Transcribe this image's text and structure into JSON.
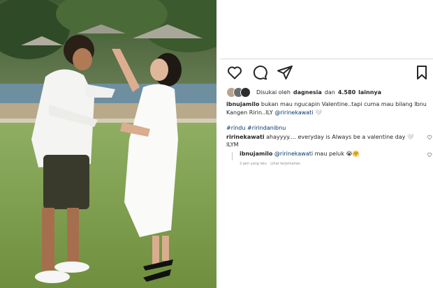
{
  "post": {
    "likes": {
      "prefix": "Disukai oleh",
      "user": "dagnesia",
      "middle": "dan",
      "count": "4.580",
      "suffix": "lainnya"
    },
    "caption": {
      "username": "ibnujamilo",
      "text": "bukan mau ngucapin Valentine..tapi cuma mau bilang Ibnu Kangen Ririn..ILY",
      "mention": "@ririnekawati",
      "emoji": "🤍"
    },
    "hashtags": [
      "#rindu",
      "#ririndanibnu"
    ],
    "comments": [
      {
        "username": "ririnekawati",
        "text": "ahayyyy.... everyday is Always be a valentine day",
        "emoji": "🤍",
        "text2": "ILYM"
      }
    ],
    "reply": {
      "username": "ibnujamilo",
      "mention": "@ririnekawati",
      "text": "mau peluk",
      "emoji": "😭🤗"
    },
    "reply_meta": {
      "time": "2 jam yang lalu",
      "action": "Lihat terjemahan"
    }
  },
  "icons": {
    "like": "heart-icon",
    "comment": "comment-bubble-icon",
    "share": "paper-plane-icon",
    "save": "bookmark-icon"
  },
  "colors": {
    "text": "#262626",
    "link": "#00376b",
    "muted": "#8e8e8e"
  }
}
